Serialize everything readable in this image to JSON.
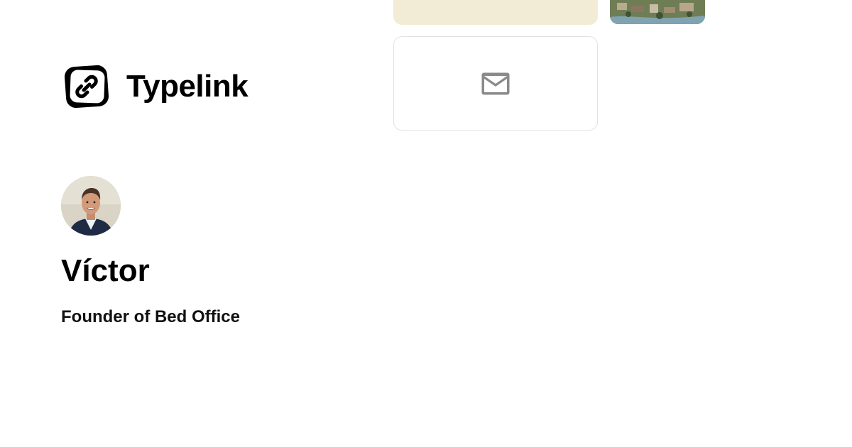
{
  "brand": {
    "name": "Typelink",
    "logo_icon": "chain-link-icon"
  },
  "profile": {
    "name": "Víctor",
    "bio": "Founder of Bed Office",
    "avatar_alt": "Víctor"
  },
  "cards": [
    {
      "kind": "color-block",
      "color": "#f2ecd7"
    },
    {
      "kind": "image",
      "description_icon": "aerial-photo"
    },
    {
      "kind": "link",
      "icon": "mail-icon",
      "icon_color": "#888888"
    }
  ],
  "colors": {
    "text": "#000000",
    "card_border": "#e2e2e2",
    "cream": "#f2ecd7"
  }
}
